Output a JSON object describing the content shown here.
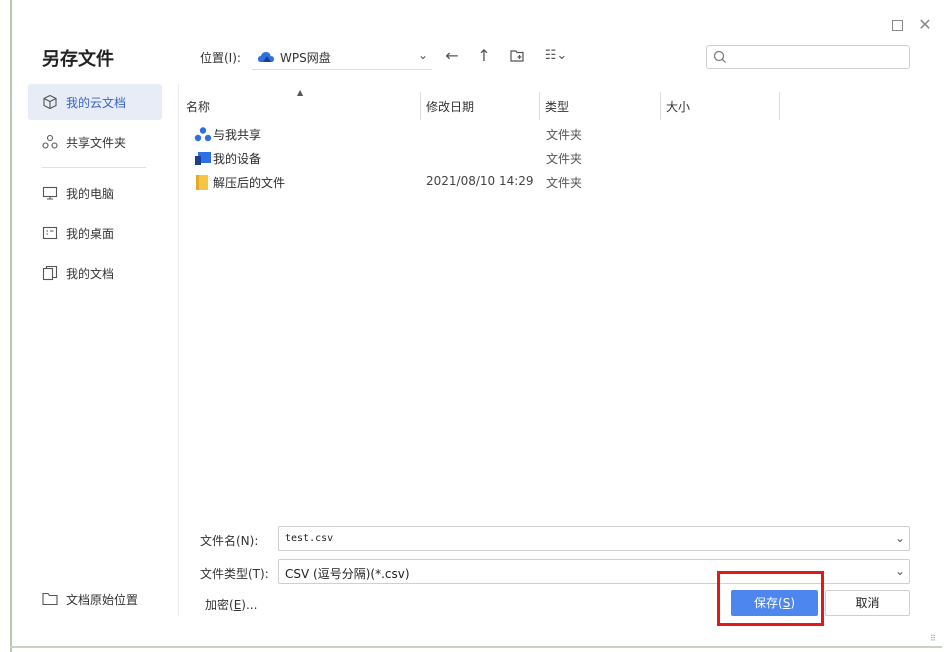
{
  "window": {
    "title": "另存文件",
    "maximize_glyph": "",
    "close_glyph": "✕"
  },
  "toolbar": {
    "location_label": "位置(I):",
    "location_value": "WPS网盘",
    "chevron": "⌄",
    "back_glyph": "←",
    "up_glyph": "↑",
    "view_glyph": "☷⌄",
    "icons": [
      "wps-cloud-icon",
      "back-arrow-icon",
      "up-arrow-icon",
      "new-folder-icon",
      "view-list-icon",
      "search-icon"
    ]
  },
  "search": {
    "placeholder": ""
  },
  "sidebar": {
    "items": [
      {
        "label": "我的云文档",
        "icon": "cloud-cube-icon",
        "active": true
      },
      {
        "label": "共享文件夹",
        "icon": "share-nodes-icon",
        "active": false
      },
      {
        "label": "我的电脑",
        "icon": "monitor-icon",
        "active": false
      },
      {
        "label": "我的桌面",
        "icon": "desktop-icon",
        "active": false
      },
      {
        "label": "我的文档",
        "icon": "documents-icon",
        "active": false
      }
    ],
    "bottom_item": {
      "label": "文档原始位置",
      "icon": "folder-outline-icon"
    }
  },
  "file_list": {
    "columns": [
      "名称",
      "修改日期",
      "类型",
      "大小"
    ],
    "sort_glyph": "▲",
    "rows": [
      {
        "name": "与我共享",
        "date": "",
        "type": "文件夹",
        "icon": "shared-with-me-icon"
      },
      {
        "name": "我的设备",
        "date": "",
        "type": "文件夹",
        "icon": "my-devices-icon"
      },
      {
        "name": "解压后的文件",
        "date": "2021/08/10 14:29",
        "type": "文件夹",
        "icon": "folder-icon"
      }
    ]
  },
  "form": {
    "filename_label": "文件名(N):",
    "filename_value": "test.csv",
    "filetype_label": "文件类型(T):",
    "filetype_value": "CSV (逗号分隔)(*.csv)",
    "encrypt_prefix": "加密(",
    "encrypt_key": "E",
    "encrypt_suffix": ")..."
  },
  "buttons": {
    "save_prefix": "保存(",
    "save_key": "S",
    "save_suffix": ")",
    "cancel": "取消"
  },
  "colors": {
    "accent": "#4e86f0",
    "active_bg": "#e7ecf7",
    "highlight": "#e3171c",
    "folder": "#f6c544",
    "cloud_blue": "#2f6fe4"
  }
}
